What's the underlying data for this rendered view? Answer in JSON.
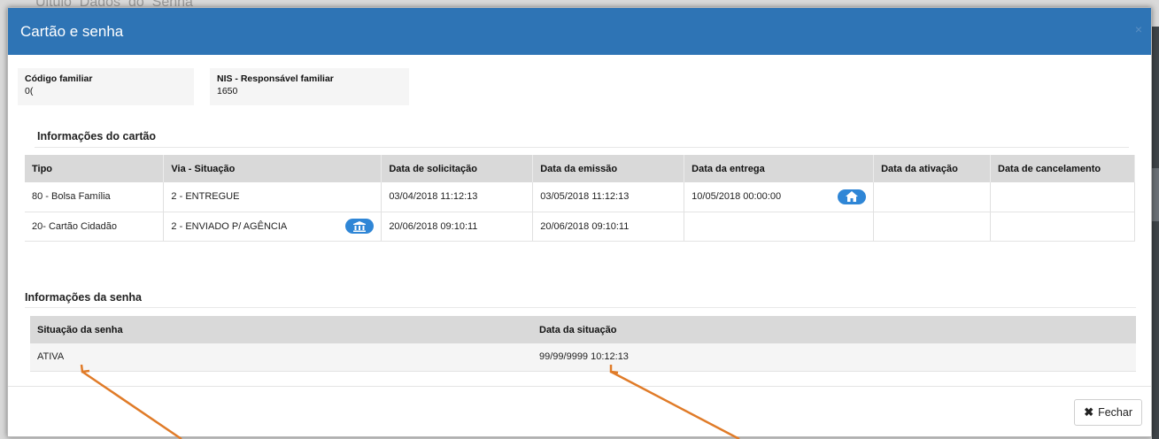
{
  "background": {
    "text": "Uitulo_Dados_do_Senha"
  },
  "modal": {
    "title": "Cartão e senha",
    "close_glyph": "×",
    "header_color": "#2e74b5"
  },
  "family_info": {
    "codigo_label": "Código familiar",
    "codigo_value": "0(",
    "nis_label": "NIS - Responsável familiar",
    "nis_value": "1650"
  },
  "card_section": {
    "title": "Informações do cartão",
    "columns": [
      "Tipo",
      "Via - Situação",
      "Data de solicitação",
      "Data da emissão",
      "Data da entrega",
      "Data da ativação",
      "Data de cancelamento"
    ],
    "rows": [
      {
        "tipo": "80 - Bolsa Família",
        "via_situacao": "2 - ENTREGUE",
        "data_solicitacao": "03/04/2018 11:12:13",
        "data_emissao": "03/05/2018 11:12:13",
        "data_entrega": "10/05/2018 00:00:00",
        "data_ativacao": "",
        "data_cancelamento": "",
        "entrega_icon": "home-icon"
      },
      {
        "tipo": "20- Cartão Cidadão",
        "via_situacao": "2 - ENVIADO P/ AGÊNCIA",
        "data_solicitacao": "20/06/2018 09:10:11",
        "data_emissao": "20/06/2018 09:10:11",
        "data_entrega": "",
        "data_ativacao": "",
        "data_cancelamento": "",
        "situacao_icon": "bank-icon"
      }
    ]
  },
  "password_section": {
    "title": "Informações da senha",
    "columns": [
      "Situação da senha",
      "Data da situação"
    ],
    "rows": [
      {
        "situacao": "ATIVA",
        "data": "99/99/9999 10:12:13"
      }
    ]
  },
  "footer": {
    "close_label": "Fechar",
    "close_icon": "close-icon"
  },
  "annotation_color": "#e07b28"
}
